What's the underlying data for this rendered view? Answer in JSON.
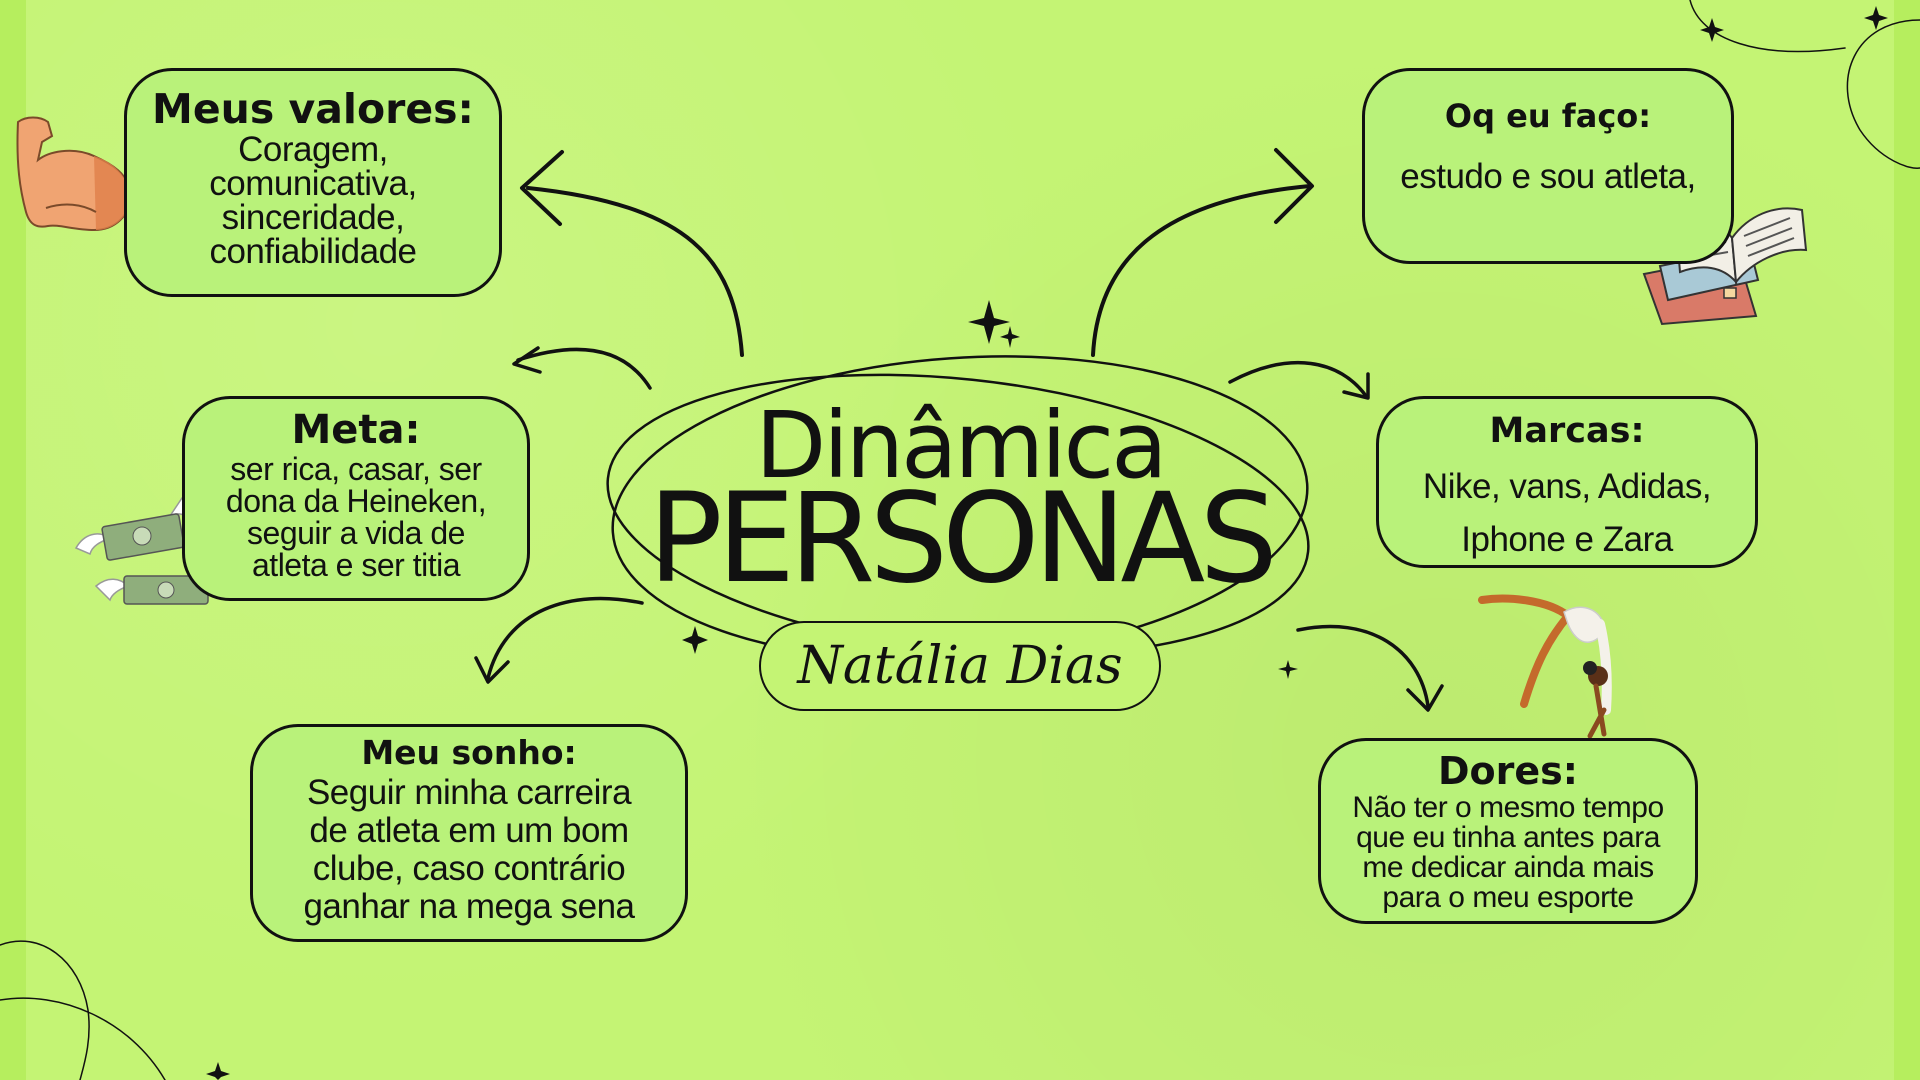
{
  "title": {
    "line1": "Dinâmica",
    "line2": "PERSONAS",
    "name": "Natália Dias"
  },
  "boxes": {
    "valores": {
      "heading": "Meus valores:",
      "lines": [
        "Coragem,",
        "comunicativa,",
        "sinceridade,",
        "confiabilidade"
      ]
    },
    "faco": {
      "heading": "Oq eu faço:",
      "lines": [
        "estudo e sou atleta,"
      ]
    },
    "meta": {
      "heading": "Meta:",
      "lines": [
        "ser rica, casar, ser",
        "dona da Heineken,",
        "seguir a vida de",
        "atleta e ser titia"
      ]
    },
    "marcas": {
      "heading": "Marcas:",
      "lines": [
        "Nike, vans, Adidas,",
        "Iphone e Zara"
      ]
    },
    "sonho": {
      "heading": "Meu sonho:",
      "lines": [
        "Seguir minha carreira",
        "de atleta em um bom",
        "clube, caso contrário",
        "ganhar na mega sena"
      ]
    },
    "dores": {
      "heading": "Dores:",
      "lines": [
        "Não ter o mesmo tempo",
        "que eu tinha antes para",
        "me dedicar ainda  mais",
        "para o meu esporte"
      ]
    }
  },
  "icons": [
    "flexed-arm-icon",
    "open-books-icon",
    "flying-money-icon",
    "gymnast-icon",
    "sparkle-icon"
  ],
  "colors": {
    "background": "#c4f474",
    "box_fill": "#b9f27a",
    "ink": "#111111"
  }
}
